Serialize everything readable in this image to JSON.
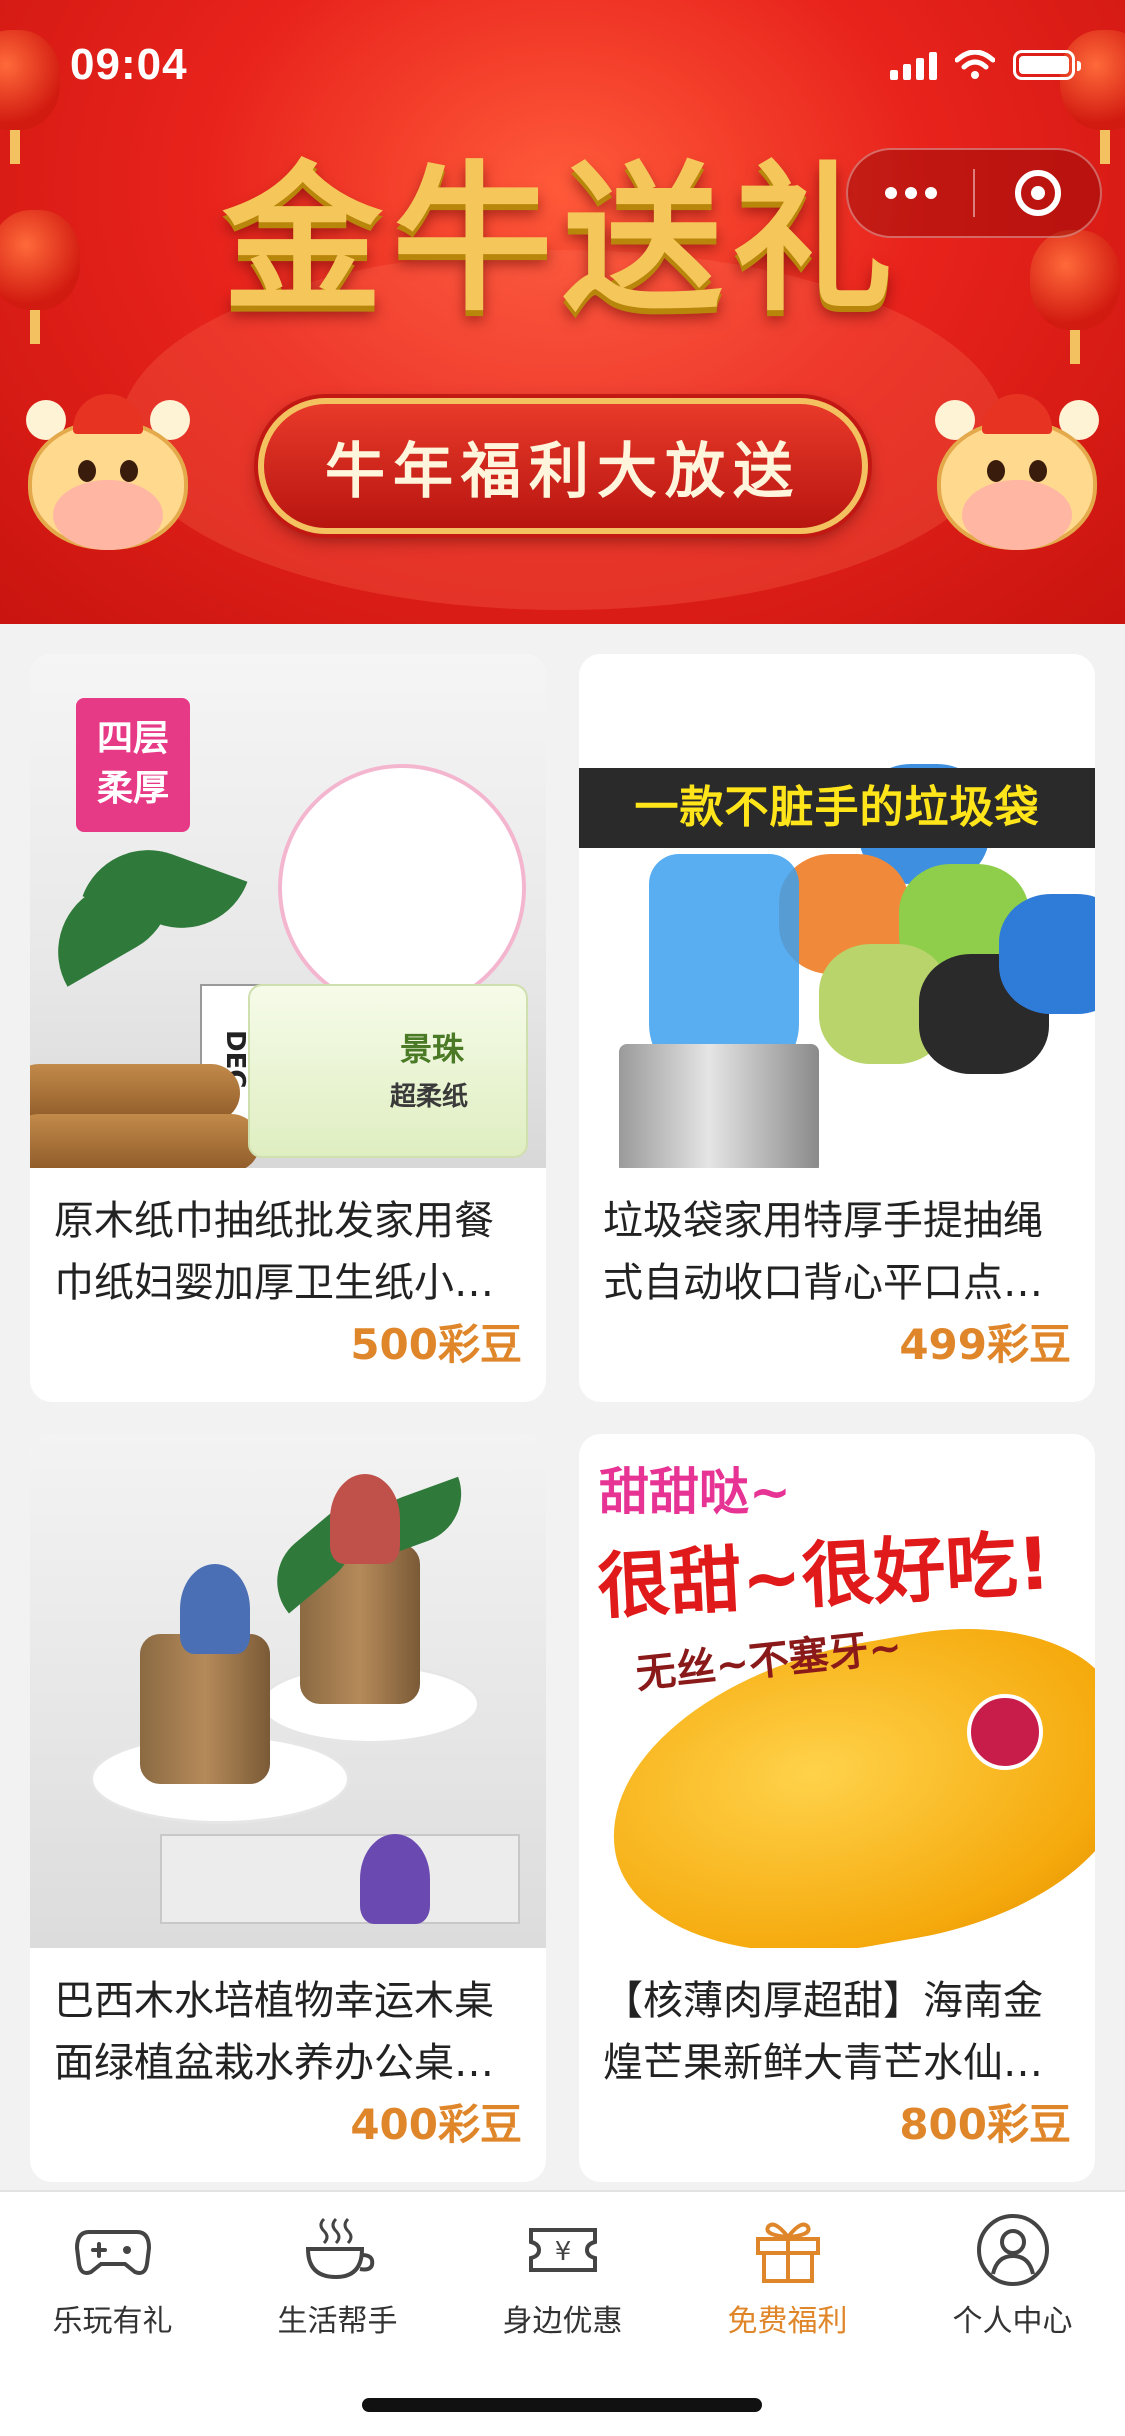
{
  "status_bar": {
    "time": "09:04"
  },
  "banner": {
    "title": "金牛送礼",
    "pill_text": "牛年福利大放送"
  },
  "products": [
    {
      "title": "原木纸巾抽纸批发家用餐巾纸妇婴加厚卫生纸小…",
      "price": "500彩豆",
      "image_tag": "四层\n柔厚",
      "pack_brand": "景珠",
      "pack_sub": "超柔纸",
      "dec_text": "DEC"
    },
    {
      "title": "垃圾袋家用特厚手提抽绳式自动收口背心平口点…",
      "price": "499彩豆",
      "image_banner": "一款不脏手的垃圾袋"
    },
    {
      "title": "巴西木水培植物幸运木桌面绿植盆栽水养办公桌…",
      "price": "400彩豆"
    },
    {
      "title": "【核薄肉厚超甜】海南金煌芒果新鲜大青芒水仙…",
      "price": "800彩豆",
      "img_line1": "甜甜哒~",
      "img_line2": "很甜~很好吃!",
      "img_line3": "无丝~不塞牙~"
    }
  ],
  "tabbar": {
    "items": [
      {
        "label": "乐玩有礼",
        "icon": "gamepad-icon"
      },
      {
        "label": "生活帮手",
        "icon": "coffee-cup-icon"
      },
      {
        "label": "身边优惠",
        "icon": "coupon-ticket-icon"
      },
      {
        "label": "免费福利",
        "icon": "gift-icon"
      },
      {
        "label": "个人中心",
        "icon": "user-icon"
      }
    ],
    "active_index": 3,
    "active_color": "#e0862a"
  },
  "colors": {
    "banner_red": "#e8231c",
    "gold": "#f5c65a",
    "price_orange": "#e0862a"
  }
}
